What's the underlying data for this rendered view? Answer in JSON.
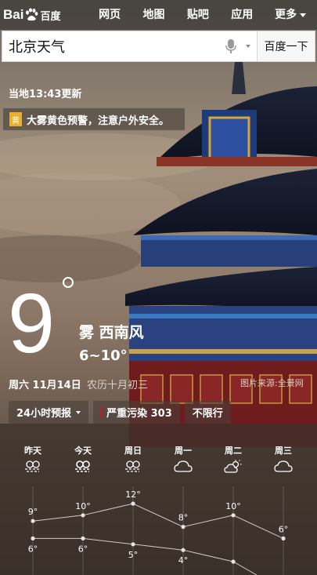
{
  "header": {
    "logo_text": "Bai",
    "logo_cn": "百度",
    "nav": [
      "网页",
      "地图",
      "贴吧",
      "应用",
      "更多"
    ]
  },
  "search": {
    "value": "北京天气",
    "button": "百度一下"
  },
  "weather": {
    "update_time": "当地13:43更新",
    "alert_badge": "黄",
    "alert_message": "大雾黄色预警，注意户外安全。",
    "current_temp": "9",
    "condition": "雾  西南风",
    "temp_range": "6~10°",
    "date": "周六 11月14日",
    "lunar_date": "农历十月初三",
    "photo_source": "图片来源:全景网",
    "chips": {
      "forecast_label": "24小时预报",
      "pollution": "严重污染 303",
      "traffic": "不限行"
    },
    "pollution_color": "#b11e2e",
    "alert_color": "#e7b12c"
  },
  "forecast": {
    "days": [
      "昨天",
      "今天",
      "周日",
      "周一",
      "周二",
      "周三"
    ],
    "icons": [
      "fog-icon",
      "fog-icon",
      "fog-icon",
      "cloud-icon",
      "partly-cloudy-icon",
      "cloud-icon"
    ],
    "high": [
      9,
      10,
      12,
      8,
      10,
      6
    ],
    "low": [
      6,
      6,
      5,
      4,
      2,
      null
    ],
    "high_labels": [
      "9°",
      "10°",
      "12°",
      "8°",
      "10°",
      "6°"
    ],
    "low_labels": [
      "6°",
      "6°",
      "5°",
      "4°",
      "",
      ""
    ]
  }
}
